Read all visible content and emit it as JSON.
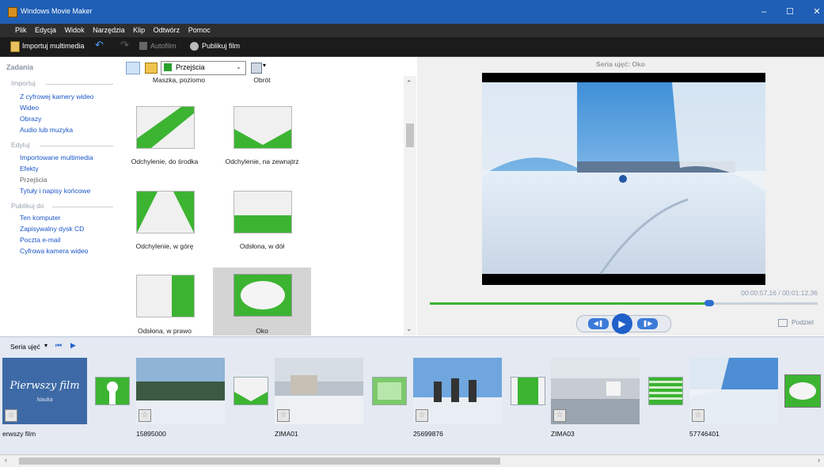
{
  "window": {
    "title": "Windows Movie Maker",
    "minimize": "–",
    "maximize": "☐",
    "close": "✕"
  },
  "menu": [
    "Plik",
    "Edycja",
    "Widok",
    "Narzędzia",
    "Klip",
    "Odtwórz",
    "Pomoc"
  ],
  "toolbar": {
    "import_label": "Importuj multimedia",
    "autofilm_label": "Autofilm",
    "publish_label": "Publikuj film"
  },
  "tasks": {
    "header": "Zadania",
    "sections": [
      {
        "title": "Importuj",
        "links": [
          "Z cyfrowej kamery wideo",
          "Wideo",
          "Obrazy",
          "Audio lub muzyka"
        ]
      },
      {
        "title": "Edytuj",
        "links": [
          "Importowane multimedia",
          "Efekty",
          "Przejścia",
          "Tytuły i napisy końcowe"
        ]
      },
      {
        "title": "Publikuj do",
        "links": [
          "Ten komputer",
          "Zapisywalny dysk CD",
          "Poczta e-mail",
          "Cyfrowa kamera wideo"
        ]
      }
    ]
  },
  "collection": {
    "dropdown_value": "Przejścia",
    "partial_labels": [
      "Maszka, poziomo",
      "Obrót"
    ],
    "items": [
      {
        "label": "Odchylenie, do środka"
      },
      {
        "label": "Odchylenie, na zewnątrz"
      },
      {
        "label": "Odchylenie, w górę"
      },
      {
        "label": "Odsłona, w dół"
      },
      {
        "label": "Odsłona, w prawo"
      },
      {
        "label": "Oko",
        "selected": true
      }
    ]
  },
  "preview": {
    "title": "Seria ujęć: Oko",
    "time": "00:00:57,16 / 00:01:12,36",
    "progress": 0.72,
    "split_label": "Podziel"
  },
  "storyboard": {
    "label": "Seria ujęć",
    "title_clip": {
      "title": "Pierwszy film",
      "subtitle": "Nauka"
    },
    "clip_labels": [
      "erwszy film",
      "15895000",
      "ZIMA01",
      "25699876",
      "ZIMA03",
      "57746401"
    ],
    "star": "☆"
  },
  "colors": {
    "accent_green": "#3cb432",
    "title_blue": "#1f5fb5",
    "link_blue": "#1a55c8"
  }
}
